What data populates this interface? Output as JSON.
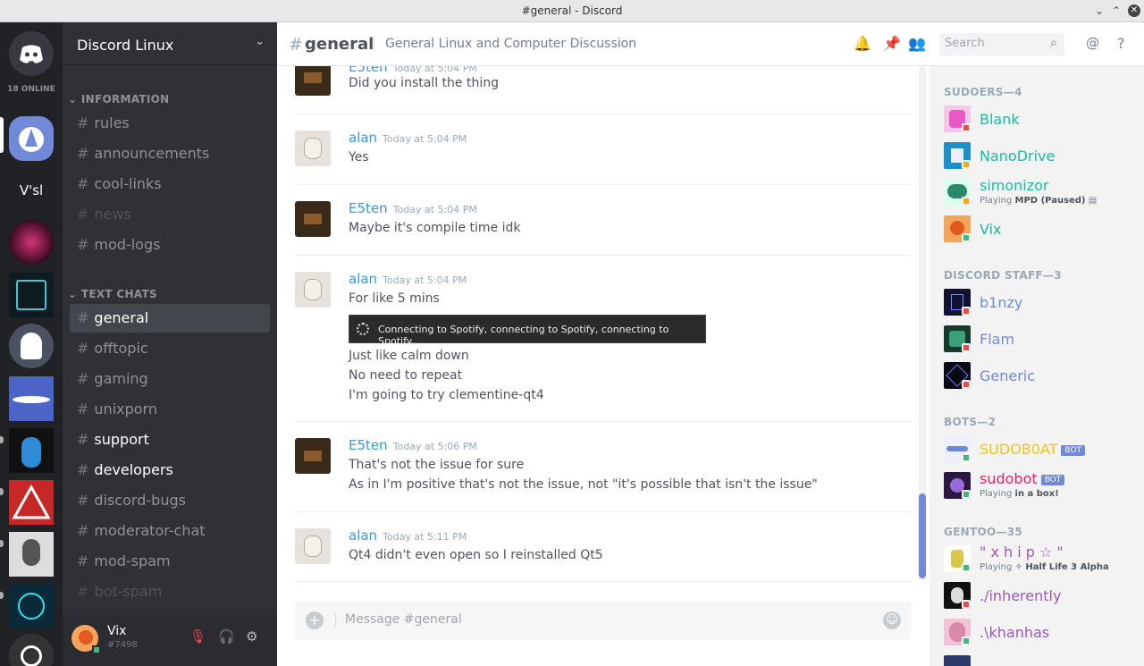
{
  "window": {
    "title": "#general - Discord"
  },
  "servers": {
    "online_label": "18 ONLINE",
    "items": [
      {
        "name": "Discord Linux"
      },
      {
        "name": "V'sl",
        "label": "V'sl"
      },
      {
        "name": "Strezz"
      },
      {
        "name": "Terminal"
      },
      {
        "name": "Ghost"
      },
      {
        "name": "Waves"
      },
      {
        "name": "Penguin"
      },
      {
        "name": "Triangle"
      },
      {
        "name": "Portrait"
      },
      {
        "name": "Cyber"
      },
      {
        "name": "Tank"
      }
    ]
  },
  "guild": {
    "name": "Discord Linux"
  },
  "categories": {
    "information": "INFORMATION",
    "text_chats": "TEXT CHATS"
  },
  "channels": {
    "information": [
      {
        "name": "rules"
      },
      {
        "name": "announcements"
      },
      {
        "name": "cool-links"
      },
      {
        "name": "news"
      },
      {
        "name": "mod-logs"
      }
    ],
    "text": [
      {
        "name": "general"
      },
      {
        "name": "offtopic"
      },
      {
        "name": "gaming"
      },
      {
        "name": "unixporn"
      },
      {
        "name": "support"
      },
      {
        "name": "developers"
      },
      {
        "name": "discord-bugs"
      },
      {
        "name": "moderator-chat"
      },
      {
        "name": "mod-spam"
      },
      {
        "name": "bot-spam"
      }
    ]
  },
  "user": {
    "name": "Vix",
    "tag": "#7498"
  },
  "header": {
    "hash": "#",
    "channel": "general",
    "topic": "General Linux and Computer Discussion",
    "search_placeholder": "Search"
  },
  "messages": [
    {
      "author": "E5ten",
      "time": "Today at 5:04 PM",
      "lines": [
        "Did you install the thing"
      ]
    },
    {
      "author": "alan",
      "time": "Today at 5:04 PM",
      "lines": [
        "Yes"
      ]
    },
    {
      "author": "E5ten",
      "time": "Today at 5:04 PM",
      "lines": [
        "Maybe it's compile time idk"
      ]
    },
    {
      "author": "alan",
      "time": "Today at 5:04 PM",
      "lines": [
        "For like 5 mins",
        "Just like calm down",
        "No need to repeat",
        "I'm going to try clementine-qt4"
      ],
      "embed": "Connecting to Spotify, connecting to Spotify, connecting to Spotify..."
    },
    {
      "author": "E5ten",
      "time": "Today at 5:06 PM",
      "lines": [
        "That's not the issue for sure",
        "As in I'm positive that's not the issue, not \"it's possible that isn't the issue\""
      ]
    },
    {
      "author": "alan",
      "time": "Today at 5:11 PM",
      "lines": [
        "Qt4 didn't even open so I reinstalled Qt5"
      ]
    }
  ],
  "composer": {
    "placeholder": "Message #general"
  },
  "members": {
    "groups": [
      {
        "label": "SUDOERS—4",
        "members": [
          {
            "name": "Blank",
            "color": "#1abc9c"
          },
          {
            "name": "NanoDrive",
            "color": "#1abc9c"
          },
          {
            "name": "simonizor",
            "color": "#1abc9c",
            "playing": "Playing",
            "game": "MPD (Paused)"
          },
          {
            "name": "Vix",
            "color": "#1abc9c"
          }
        ]
      },
      {
        "label": "DISCORD STAFF—3",
        "members": [
          {
            "name": "b1nzy",
            "color": "#7289da"
          },
          {
            "name": "Flam",
            "color": "#7289da"
          },
          {
            "name": "Generic",
            "color": "#7289da"
          }
        ]
      },
      {
        "label": "BOTS—2",
        "members": [
          {
            "name": "SUDOB0AT",
            "color": "#f1c40f",
            "bot": "BOT"
          },
          {
            "name": "sudobot",
            "color": "#e91e63",
            "bot": "BOT",
            "playing": "Playing",
            "game": "in a box!"
          }
        ]
      },
      {
        "label": "GENTOO—35",
        "members": [
          {
            "name": "\" x h i p ☆ \"",
            "color": "#9b59b6",
            "playing": "Playing",
            "game": "✧ Half Life 3 Alpha"
          },
          {
            "name": "./inherently",
            "color": "#9b59b6"
          },
          {
            "name": ".\\khanhas",
            "color": "#9b59b6"
          }
        ]
      }
    ]
  },
  "colors": {
    "accent": "#7289da",
    "status_online": "#43b581",
    "status_dnd": "#f04747",
    "status_idle": "#faa61a"
  }
}
